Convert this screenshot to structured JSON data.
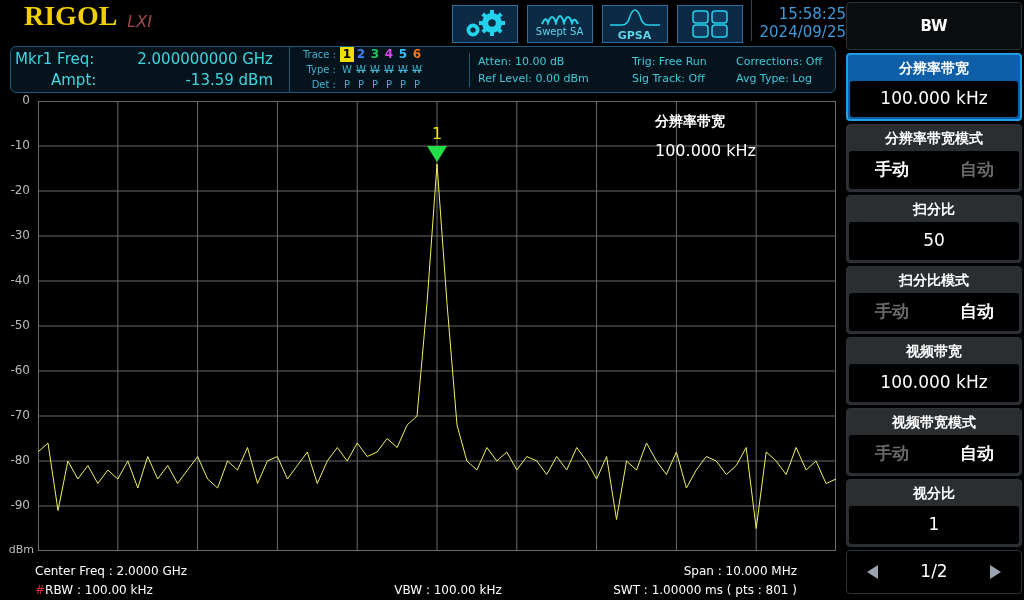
{
  "logo": {
    "brand": "RIGOL",
    "badge": "LXI"
  },
  "mode_buttons": [
    {
      "kind": "gears"
    },
    {
      "kind": "swept",
      "label": "Swept SA"
    },
    {
      "kind": "gpsa",
      "label": "GPSA"
    },
    {
      "kind": "grid"
    }
  ],
  "clock": {
    "time": "15:58:25",
    "date": "2024/09/25"
  },
  "marker_readout": {
    "freq_label": "Mkr1 Freq:",
    "freq": "2.000000000 GHz",
    "ampt_label": "Ampt:",
    "ampt": "-13.59 dBm"
  },
  "traces": {
    "trace_label": "Trace :",
    "type_label": "Type :",
    "det_label": "Det :",
    "items": [
      {
        "number": "1",
        "color": "#f0e000",
        "selected": true,
        "type": "W",
        "type_off": false,
        "det": "P"
      },
      {
        "number": "2",
        "color": "#3b82f6",
        "selected": false,
        "type": "W",
        "type_off": true,
        "det": "P"
      },
      {
        "number": "3",
        "color": "#22c55e",
        "selected": false,
        "type": "W",
        "type_off": true,
        "det": "P"
      },
      {
        "number": "4",
        "color": "#d946ef",
        "selected": false,
        "type": "W",
        "type_off": true,
        "det": "P"
      },
      {
        "number": "5",
        "color": "#38bdf8",
        "selected": false,
        "type": "W",
        "type_off": true,
        "det": "P"
      },
      {
        "number": "6",
        "color": "#f97316",
        "selected": false,
        "type": "W",
        "type_off": true,
        "det": "P"
      }
    ]
  },
  "settings": [
    [
      "Atten: 10.00 dB",
      "Ref Level: 0.00 dBm"
    ],
    [
      "Trig: Free Run",
      "Sig Track: Off"
    ],
    [
      "Corrections: Off",
      "Avg Type: Log"
    ]
  ],
  "plot": {
    "marker_label": "1",
    "overlay_title": "分辨率带宽",
    "overlay_value": "100.000 kHz",
    "chart_data": {
      "type": "line",
      "grid": true,
      "ylabel": "dBm",
      "ylim": [
        -100,
        0
      ],
      "yticks": [
        0,
        -10,
        -20,
        -30,
        -40,
        -50,
        -60,
        -70,
        -80,
        -90
      ],
      "series": [
        {
          "color": "#f0f060",
          "values": [
            -78,
            -76,
            -91,
            -80,
            -84,
            -81,
            -85,
            -82,
            -84,
            -80,
            -86,
            -79,
            -84,
            -81,
            -85,
            -82,
            -79,
            -84,
            -86,
            -80,
            -82,
            -77,
            -85,
            -80,
            -79,
            -84,
            -81,
            -78,
            -85,
            -80,
            -77,
            -80,
            -76,
            -79,
            -78,
            -75,
            -77,
            -72,
            -70,
            -45,
            -14,
            -45,
            -72,
            -80,
            -82,
            -77,
            -80,
            -78,
            -82,
            -79,
            -80,
            -83,
            -79,
            -82,
            -77,
            -80,
            -84,
            -79,
            -93,
            -80,
            -82,
            -76,
            -80,
            -83,
            -78,
            -86,
            -82,
            -79,
            -80,
            -83,
            -81,
            -77,
            -95,
            -78,
            -80,
            -83,
            -77,
            -82,
            -80,
            -85,
            -84
          ]
        }
      ]
    }
  },
  "footer": {
    "center": "Center Freq : 2.0000 GHz",
    "span": "Span : 10.000 MHz",
    "rbw_flag": "#",
    "rbw": "RBW : 100.00 kHz",
    "vbw": "VBW : 100.00 kHz",
    "swt": "SWT : 1.00000 ms ( pts : 801 )"
  },
  "softkeys": [
    {
      "kind": "title",
      "label": "BW",
      "selected": false
    },
    {
      "kind": "value",
      "label": "分辨率带宽",
      "value": "100.000 kHz",
      "selected": true
    },
    {
      "kind": "mode",
      "label": "分辨率带宽模式",
      "options": [
        {
          "label": "手动",
          "selected": true
        },
        {
          "label": "自动",
          "selected": false
        }
      ],
      "selected": false
    },
    {
      "kind": "value",
      "label": "扫分比",
      "value": "50",
      "selected": false
    },
    {
      "kind": "mode",
      "label": "扫分比模式",
      "options": [
        {
          "label": "手动",
          "selected": false
        },
        {
          "label": "自动",
          "selected": true
        }
      ],
      "selected": false
    },
    {
      "kind": "value",
      "label": "视频带宽",
      "value": "100.000 kHz",
      "selected": false
    },
    {
      "kind": "mode",
      "label": "视频带宽模式",
      "options": [
        {
          "label": "手动",
          "selected": false
        },
        {
          "label": "自动",
          "selected": true
        }
      ],
      "selected": false
    },
    {
      "kind": "value",
      "label": "视分比",
      "value": "1",
      "selected": false
    },
    {
      "kind": "page",
      "label": "1/2",
      "selected": false
    }
  ]
}
